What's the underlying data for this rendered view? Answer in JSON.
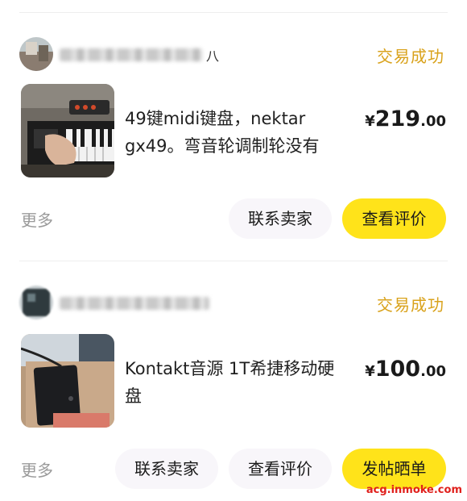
{
  "orders": [
    {
      "seller_suffix": "八",
      "status": "交易成功",
      "title": "49键midi键盘，nektar gx49。弯音轮调制轮没有",
      "price": {
        "currency": "¥",
        "integer": "219",
        "decimal": ".00"
      },
      "more_label": "更多",
      "buttons": [
        "联系卖家",
        "查看评价"
      ]
    },
    {
      "seller_suffix": "",
      "status": "交易成功",
      "title": "Kontakt音源 1T希捷移动硬盘",
      "price": {
        "currency": "¥",
        "integer": "100",
        "decimal": ".00"
      },
      "more_label": "更多",
      "buttons": [
        "联系卖家",
        "查看评价",
        "发帖晒单"
      ]
    }
  ],
  "watermark": "acg.inmoke.com",
  "colors": {
    "status": "#d9a21b",
    "primary_button": "#ffe31a",
    "secondary_button": "#f8f6fa",
    "watermark": "#e0201c"
  }
}
